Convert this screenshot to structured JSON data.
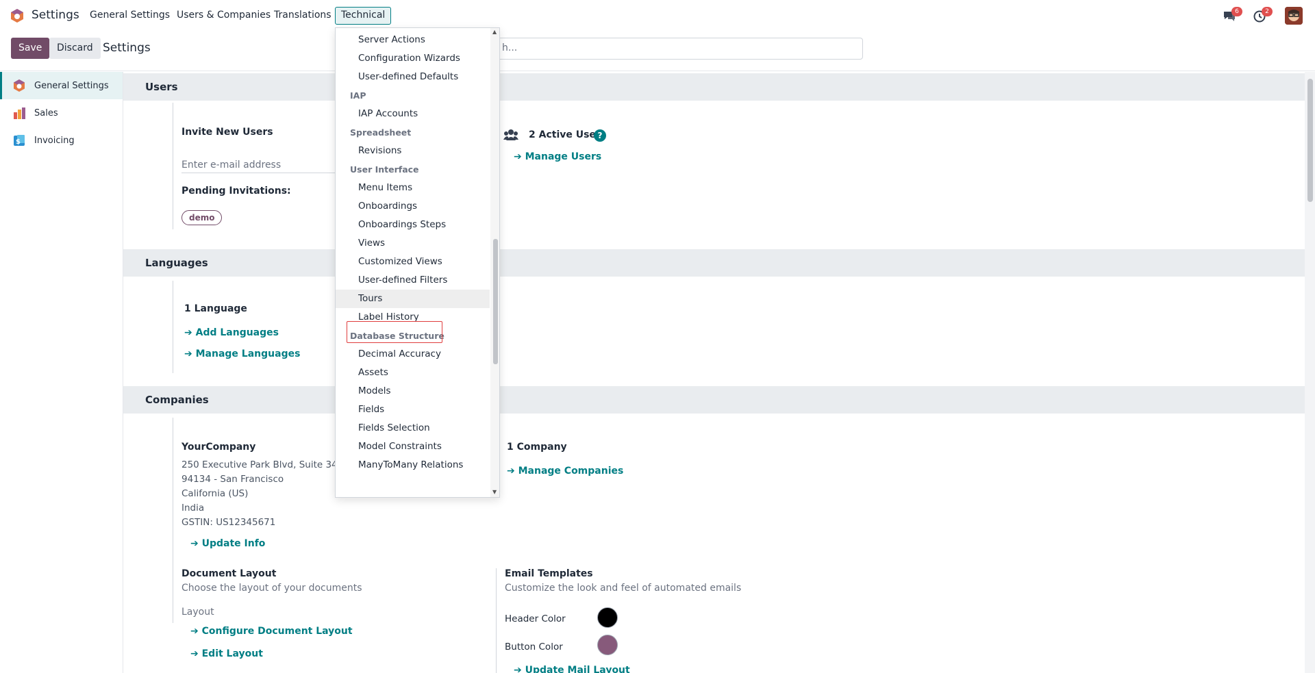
{
  "navbar": {
    "app_title": "Settings",
    "menu": [
      "General Settings",
      "Users & Companies",
      "Translations",
      "Technical"
    ],
    "chat_badge": "6",
    "activity_badge": "2"
  },
  "control_panel": {
    "save_label": "Save",
    "discard_label": "Discard",
    "title": "Settings",
    "search_value": "h..."
  },
  "sidebar": {
    "items": [
      {
        "label": "General Settings",
        "icon": "settings-app-icon"
      },
      {
        "label": "Sales",
        "icon": "sales-app-icon"
      },
      {
        "label": "Invoicing",
        "icon": "invoicing-app-icon"
      }
    ]
  },
  "users": {
    "header": "Users",
    "invite_title": "Invite New Users",
    "email_placeholder": "Enter e-mail address",
    "pending_label": "Pending Invitations:",
    "pending_tag": "demo",
    "active_users": "2 Active User",
    "manage_users": "Manage Users"
  },
  "languages": {
    "header": "Languages",
    "count": "1 Language",
    "add": "Add Languages",
    "manage": "Manage Languages"
  },
  "companies": {
    "header": "Companies",
    "company_name": "YourCompany",
    "address_lines": [
      "250 Executive Park Blvd, Suite 3400",
      "94134 - San Francisco",
      "California (US)",
      "India",
      "GSTIN:  US12345671"
    ],
    "update_info": "Update Info",
    "count": "1 Company",
    "manage": "Manage Companies",
    "doc_layout_title": "Document Layout",
    "doc_layout_desc": "Choose the layout of your documents",
    "layout_label": "Layout",
    "configure_layout": "Configure Document Layout",
    "edit_layout": "Edit Layout",
    "email_templates_title": "Email Templates",
    "email_templates_desc": "Customize the look and feel of automated emails",
    "header_color_label": "Header Color",
    "button_color_label": "Button Color",
    "update_mail_layout": "Update Mail Layout",
    "header_color": "#000000",
    "button_color": "#875a7b"
  },
  "technical_menu": {
    "items": [
      {
        "type": "item",
        "label": "Server Actions"
      },
      {
        "type": "item",
        "label": "Configuration Wizards"
      },
      {
        "type": "item",
        "label": "User-defined Defaults"
      },
      {
        "type": "header",
        "label": "IAP"
      },
      {
        "type": "item",
        "label": "IAP Accounts"
      },
      {
        "type": "header",
        "label": "Spreadsheet"
      },
      {
        "type": "item",
        "label": "Revisions"
      },
      {
        "type": "header",
        "label": "User Interface"
      },
      {
        "type": "item",
        "label": "Menu Items"
      },
      {
        "type": "item",
        "label": "Onboardings"
      },
      {
        "type": "item",
        "label": "Onboardings Steps"
      },
      {
        "type": "item",
        "label": "Views"
      },
      {
        "type": "item",
        "label": "Customized Views"
      },
      {
        "type": "item",
        "label": "User-defined Filters"
      },
      {
        "type": "item",
        "label": "Tours"
      },
      {
        "type": "item",
        "label": "Label History"
      },
      {
        "type": "header",
        "label": "Database Structure"
      },
      {
        "type": "item",
        "label": "Decimal Accuracy"
      },
      {
        "type": "item",
        "label": "Assets"
      },
      {
        "type": "item",
        "label": "Models"
      },
      {
        "type": "item",
        "label": "Fields"
      },
      {
        "type": "item",
        "label": "Fields Selection"
      },
      {
        "type": "item",
        "label": "Model Constraints"
      },
      {
        "type": "item",
        "label": "ManyToMany Relations"
      }
    ]
  },
  "colors": {
    "brand": "#714b67",
    "accent": "#017e84"
  }
}
